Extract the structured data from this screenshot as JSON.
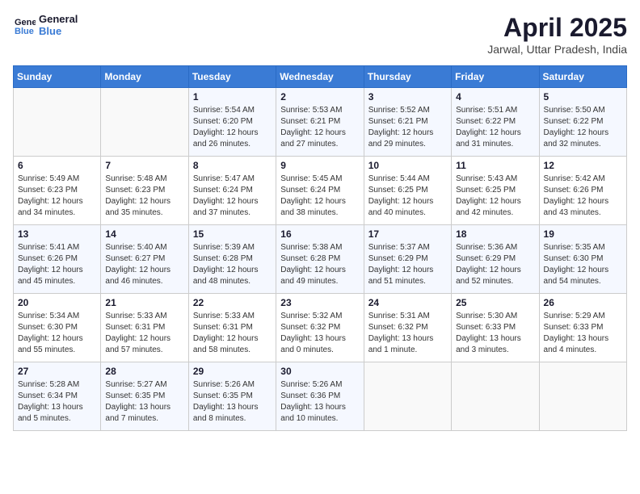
{
  "header": {
    "logo_line1": "General",
    "logo_line2": "Blue",
    "month": "April 2025",
    "location": "Jarwal, Uttar Pradesh, India"
  },
  "weekdays": [
    "Sunday",
    "Monday",
    "Tuesday",
    "Wednesday",
    "Thursday",
    "Friday",
    "Saturday"
  ],
  "weeks": [
    [
      {
        "day": "",
        "sunrise": "",
        "sunset": "",
        "daylight": ""
      },
      {
        "day": "",
        "sunrise": "",
        "sunset": "",
        "daylight": ""
      },
      {
        "day": "1",
        "sunrise": "Sunrise: 5:54 AM",
        "sunset": "Sunset: 6:20 PM",
        "daylight": "Daylight: 12 hours and 26 minutes."
      },
      {
        "day": "2",
        "sunrise": "Sunrise: 5:53 AM",
        "sunset": "Sunset: 6:21 PM",
        "daylight": "Daylight: 12 hours and 27 minutes."
      },
      {
        "day": "3",
        "sunrise": "Sunrise: 5:52 AM",
        "sunset": "Sunset: 6:21 PM",
        "daylight": "Daylight: 12 hours and 29 minutes."
      },
      {
        "day": "4",
        "sunrise": "Sunrise: 5:51 AM",
        "sunset": "Sunset: 6:22 PM",
        "daylight": "Daylight: 12 hours and 31 minutes."
      },
      {
        "day": "5",
        "sunrise": "Sunrise: 5:50 AM",
        "sunset": "Sunset: 6:22 PM",
        "daylight": "Daylight: 12 hours and 32 minutes."
      }
    ],
    [
      {
        "day": "6",
        "sunrise": "Sunrise: 5:49 AM",
        "sunset": "Sunset: 6:23 PM",
        "daylight": "Daylight: 12 hours and 34 minutes."
      },
      {
        "day": "7",
        "sunrise": "Sunrise: 5:48 AM",
        "sunset": "Sunset: 6:23 PM",
        "daylight": "Daylight: 12 hours and 35 minutes."
      },
      {
        "day": "8",
        "sunrise": "Sunrise: 5:47 AM",
        "sunset": "Sunset: 6:24 PM",
        "daylight": "Daylight: 12 hours and 37 minutes."
      },
      {
        "day": "9",
        "sunrise": "Sunrise: 5:45 AM",
        "sunset": "Sunset: 6:24 PM",
        "daylight": "Daylight: 12 hours and 38 minutes."
      },
      {
        "day": "10",
        "sunrise": "Sunrise: 5:44 AM",
        "sunset": "Sunset: 6:25 PM",
        "daylight": "Daylight: 12 hours and 40 minutes."
      },
      {
        "day": "11",
        "sunrise": "Sunrise: 5:43 AM",
        "sunset": "Sunset: 6:25 PM",
        "daylight": "Daylight: 12 hours and 42 minutes."
      },
      {
        "day": "12",
        "sunrise": "Sunrise: 5:42 AM",
        "sunset": "Sunset: 6:26 PM",
        "daylight": "Daylight: 12 hours and 43 minutes."
      }
    ],
    [
      {
        "day": "13",
        "sunrise": "Sunrise: 5:41 AM",
        "sunset": "Sunset: 6:26 PM",
        "daylight": "Daylight: 12 hours and 45 minutes."
      },
      {
        "day": "14",
        "sunrise": "Sunrise: 5:40 AM",
        "sunset": "Sunset: 6:27 PM",
        "daylight": "Daylight: 12 hours and 46 minutes."
      },
      {
        "day": "15",
        "sunrise": "Sunrise: 5:39 AM",
        "sunset": "Sunset: 6:28 PM",
        "daylight": "Daylight: 12 hours and 48 minutes."
      },
      {
        "day": "16",
        "sunrise": "Sunrise: 5:38 AM",
        "sunset": "Sunset: 6:28 PM",
        "daylight": "Daylight: 12 hours and 49 minutes."
      },
      {
        "day": "17",
        "sunrise": "Sunrise: 5:37 AM",
        "sunset": "Sunset: 6:29 PM",
        "daylight": "Daylight: 12 hours and 51 minutes."
      },
      {
        "day": "18",
        "sunrise": "Sunrise: 5:36 AM",
        "sunset": "Sunset: 6:29 PM",
        "daylight": "Daylight: 12 hours and 52 minutes."
      },
      {
        "day": "19",
        "sunrise": "Sunrise: 5:35 AM",
        "sunset": "Sunset: 6:30 PM",
        "daylight": "Daylight: 12 hours and 54 minutes."
      }
    ],
    [
      {
        "day": "20",
        "sunrise": "Sunrise: 5:34 AM",
        "sunset": "Sunset: 6:30 PM",
        "daylight": "Daylight: 12 hours and 55 minutes."
      },
      {
        "day": "21",
        "sunrise": "Sunrise: 5:33 AM",
        "sunset": "Sunset: 6:31 PM",
        "daylight": "Daylight: 12 hours and 57 minutes."
      },
      {
        "day": "22",
        "sunrise": "Sunrise: 5:33 AM",
        "sunset": "Sunset: 6:31 PM",
        "daylight": "Daylight: 12 hours and 58 minutes."
      },
      {
        "day": "23",
        "sunrise": "Sunrise: 5:32 AM",
        "sunset": "Sunset: 6:32 PM",
        "daylight": "Daylight: 13 hours and 0 minutes."
      },
      {
        "day": "24",
        "sunrise": "Sunrise: 5:31 AM",
        "sunset": "Sunset: 6:32 PM",
        "daylight": "Daylight: 13 hours and 1 minute."
      },
      {
        "day": "25",
        "sunrise": "Sunrise: 5:30 AM",
        "sunset": "Sunset: 6:33 PM",
        "daylight": "Daylight: 13 hours and 3 minutes."
      },
      {
        "day": "26",
        "sunrise": "Sunrise: 5:29 AM",
        "sunset": "Sunset: 6:33 PM",
        "daylight": "Daylight: 13 hours and 4 minutes."
      }
    ],
    [
      {
        "day": "27",
        "sunrise": "Sunrise: 5:28 AM",
        "sunset": "Sunset: 6:34 PM",
        "daylight": "Daylight: 13 hours and 5 minutes."
      },
      {
        "day": "28",
        "sunrise": "Sunrise: 5:27 AM",
        "sunset": "Sunset: 6:35 PM",
        "daylight": "Daylight: 13 hours and 7 minutes."
      },
      {
        "day": "29",
        "sunrise": "Sunrise: 5:26 AM",
        "sunset": "Sunset: 6:35 PM",
        "daylight": "Daylight: 13 hours and 8 minutes."
      },
      {
        "day": "30",
        "sunrise": "Sunrise: 5:26 AM",
        "sunset": "Sunset: 6:36 PM",
        "daylight": "Daylight: 13 hours and 10 minutes."
      },
      {
        "day": "",
        "sunrise": "",
        "sunset": "",
        "daylight": ""
      },
      {
        "day": "",
        "sunrise": "",
        "sunset": "",
        "daylight": ""
      },
      {
        "day": "",
        "sunrise": "",
        "sunset": "",
        "daylight": ""
      }
    ]
  ]
}
